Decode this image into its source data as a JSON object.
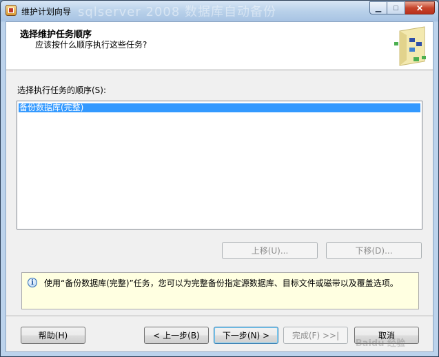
{
  "window": {
    "title": "维护计划向导",
    "ghost_title": "sqlserver 2008 数据库自动备份"
  },
  "caption": {
    "minimize": "▁",
    "maximize": "□",
    "close": "✕"
  },
  "header": {
    "title": "选择维护任务顺序",
    "subtitle": "应该按什么顺序执行这些任务?"
  },
  "task_list": {
    "label": "选择执行任务的顺序(S):",
    "items": [
      "备份数据库(完整)"
    ],
    "selected_index": 0
  },
  "order_buttons": {
    "move_up": "上移(U)...",
    "move_down": "下移(D)..."
  },
  "info": {
    "icon": "info-icon",
    "text": "使用“备份数据库(完整)”任务，您可以为完整备份指定源数据库、目标文件或磁带以及覆盖选项。"
  },
  "footer": {
    "help": "帮助(H)",
    "back": "< 上一步(B)",
    "next": "下一步(N) >",
    "finish": "完成(F) >>|",
    "cancel": "取消"
  },
  "watermark": "Baidu 经验",
  "colors": {
    "selection": "#3399ff",
    "info_background": "#ffffe1",
    "close_button": "#c7452c"
  }
}
